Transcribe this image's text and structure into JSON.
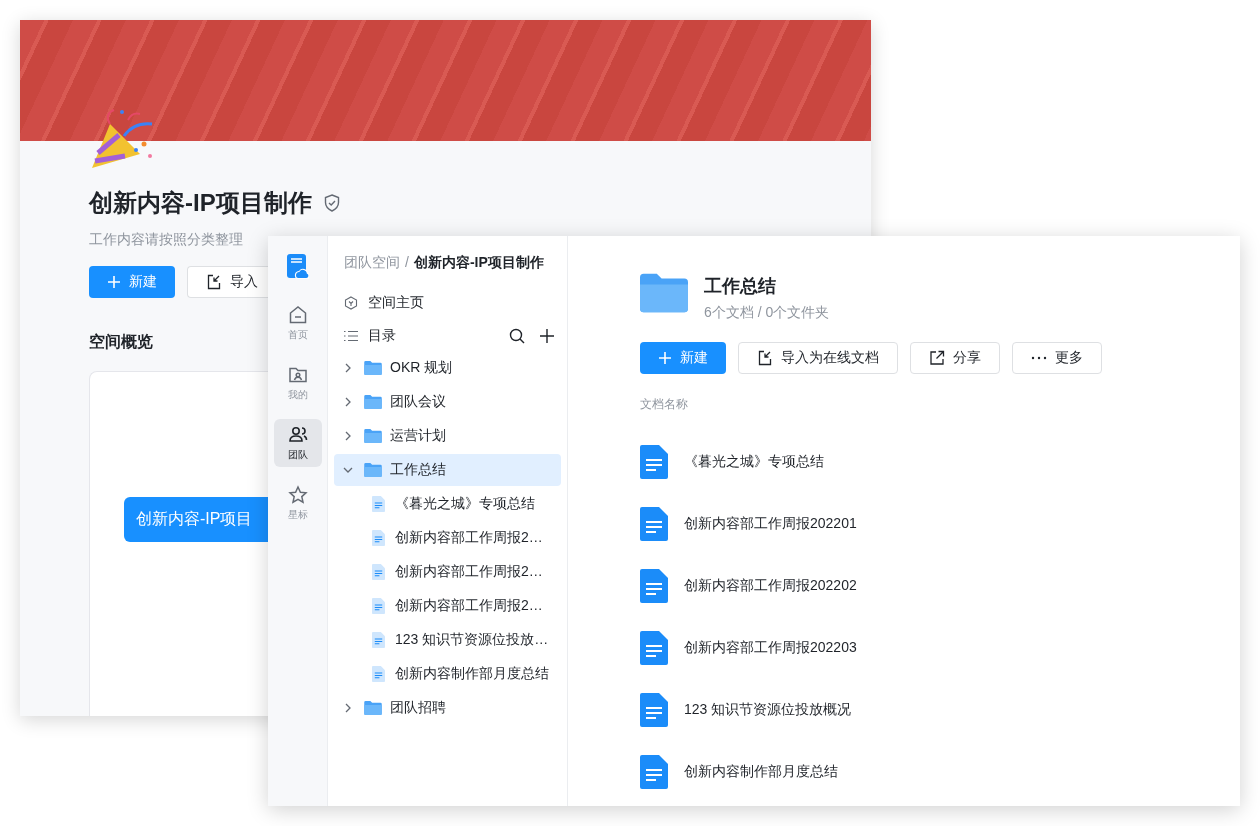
{
  "background_window": {
    "title": "创新内容-IP项目制作",
    "subtitle": "工作内容请按照分类整理",
    "buttons": [
      {
        "kind": "primary",
        "label": "新建"
      },
      {
        "kind": "import",
        "label": "导入"
      }
    ],
    "section_title": "空间概览",
    "card": {
      "pill": "创新内容-IP项目"
    }
  },
  "front_window": {
    "nav": [
      {
        "kind": "home",
        "label": "首页",
        "selected": false
      },
      {
        "kind": "mine",
        "label": "我的",
        "selected": false
      },
      {
        "kind": "team",
        "label": "团队",
        "selected": true
      },
      {
        "kind": "star",
        "label": "星标",
        "selected": false
      }
    ],
    "breadcrumb": {
      "items": [
        "团队空间",
        "创新内容-IP项目制作"
      ],
      "separator": "/"
    },
    "space_home": "空间主页",
    "catalog": "目录",
    "tree": [
      {
        "kind": "folder",
        "label": "OKR 规划",
        "expanded": false,
        "selected": false
      },
      {
        "kind": "folder",
        "label": "团队会议",
        "expanded": false,
        "selected": false
      },
      {
        "kind": "folder",
        "label": "运营计划",
        "expanded": false,
        "selected": false
      },
      {
        "kind": "folder",
        "label": "工作总结",
        "expanded": true,
        "selected": true,
        "children": [
          {
            "kind": "doc",
            "label": "《暮光之城》专项总结",
            "selected": false
          },
          {
            "kind": "doc",
            "label": "创新内容部工作周报2…",
            "selected": false
          },
          {
            "kind": "doc",
            "label": "创新内容部工作周报2…",
            "selected": false
          },
          {
            "kind": "doc",
            "label": "创新内容部工作周报2…",
            "selected": false
          },
          {
            "kind": "doc",
            "label": "123 知识节资源位投放…",
            "selected": false
          },
          {
            "kind": "doc",
            "label": "创新内容制作部月度总结",
            "selected": false
          }
        ]
      },
      {
        "kind": "folder",
        "label": "团队招聘",
        "expanded": false,
        "selected": false
      }
    ],
    "folder": {
      "title": "工作总结",
      "meta": "6个文档 / 0个文件夹"
    },
    "buttons": [
      {
        "kind": "primary",
        "label": "新建"
      },
      {
        "kind": "import",
        "label": "导入为在线文档"
      },
      {
        "kind": "share",
        "label": "分享"
      },
      {
        "kind": "more",
        "label": "更多"
      }
    ],
    "column": "文档名称",
    "documents": [
      "《暮光之城》专项总结",
      "创新内容部工作周报202201",
      "创新内容部工作周报202202",
      "创新内容部工作周报202203",
      "123 知识节资源位投放概况",
      "创新内容制作部月度总结"
    ]
  }
}
